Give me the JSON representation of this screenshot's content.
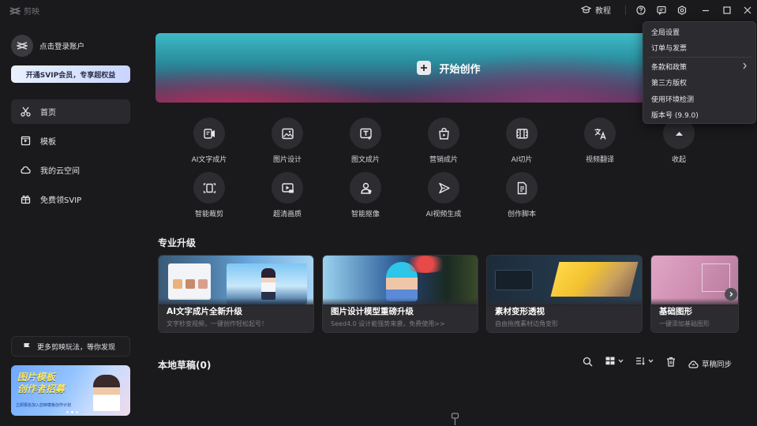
{
  "titlebar": {
    "app_name": "剪映",
    "tutorial_label": "教程",
    "icons": [
      "help-icon",
      "feedback-icon",
      "settings-icon",
      "minimize-icon",
      "maximize-icon",
      "close-icon"
    ]
  },
  "sidebar": {
    "login_label": "点击登录账户",
    "vip_banner": "开通SVIP会员，专享超权益",
    "items": [
      {
        "label": "首页",
        "icon": "scissors-icon",
        "active": true
      },
      {
        "label": "模板",
        "icon": "template-icon",
        "active": false
      },
      {
        "label": "我的云空间",
        "icon": "cloud-icon",
        "active": false
      },
      {
        "label": "免费领SVIP",
        "icon": "gift-icon",
        "active": false
      }
    ],
    "discover_label": "更多剪映玩法，等你发现",
    "promo": {
      "title": "图片模板\n创作者招募",
      "subtitle": "立即报名加入剪映模板创作计划"
    }
  },
  "hero": {
    "label": "开始创作"
  },
  "tools": [
    {
      "label": "AI文字成片",
      "icon": "ai-text-video-icon"
    },
    {
      "label": "图片设计",
      "icon": "image-design-icon"
    },
    {
      "label": "图文成片",
      "icon": "text-image-video-icon"
    },
    {
      "label": "营销成片",
      "icon": "shopping-bag-icon"
    },
    {
      "label": "AI切片",
      "icon": "ai-slice-icon"
    },
    {
      "label": "视频翻译",
      "icon": "translate-icon"
    },
    {
      "label": "收起",
      "icon": "collapse-icon"
    },
    {
      "label": "智能裁剪",
      "icon": "smart-crop-icon"
    },
    {
      "label": "超清画质",
      "icon": "hd-quality-icon"
    },
    {
      "label": "智能抠像",
      "icon": "cutout-icon"
    },
    {
      "label": "AI视频生成",
      "icon": "ai-video-generate-icon"
    },
    {
      "label": "创作脚本",
      "icon": "script-icon"
    }
  ],
  "pro_upgrade": {
    "title": "专业升级",
    "cards": [
      {
        "title": "AI文字成片全新升级",
        "desc": "文字秒变视频，一键创作轻松起号！"
      },
      {
        "title": "图片设计模型重磅升级",
        "desc": "Seed4.0 设计能强势来袭，免费使用>>"
      },
      {
        "title": "素材变形透视",
        "desc": "自由拖拽素材边角变形"
      },
      {
        "title": "基础图形",
        "desc": "一键添加基础图形"
      }
    ]
  },
  "drafts": {
    "title": "本地草稿(0)",
    "sync_label": "草稿同步"
  },
  "menu": {
    "items": [
      "全局设置",
      "订单与发票",
      "条款和政策",
      "第三方版权",
      "使用环境检测",
      "版本号 (9.9.0)"
    ]
  },
  "colors": {
    "background": "#1a1a1c",
    "accent_vip": "#d6e2ff",
    "menu_bg": "#2c2c30"
  }
}
